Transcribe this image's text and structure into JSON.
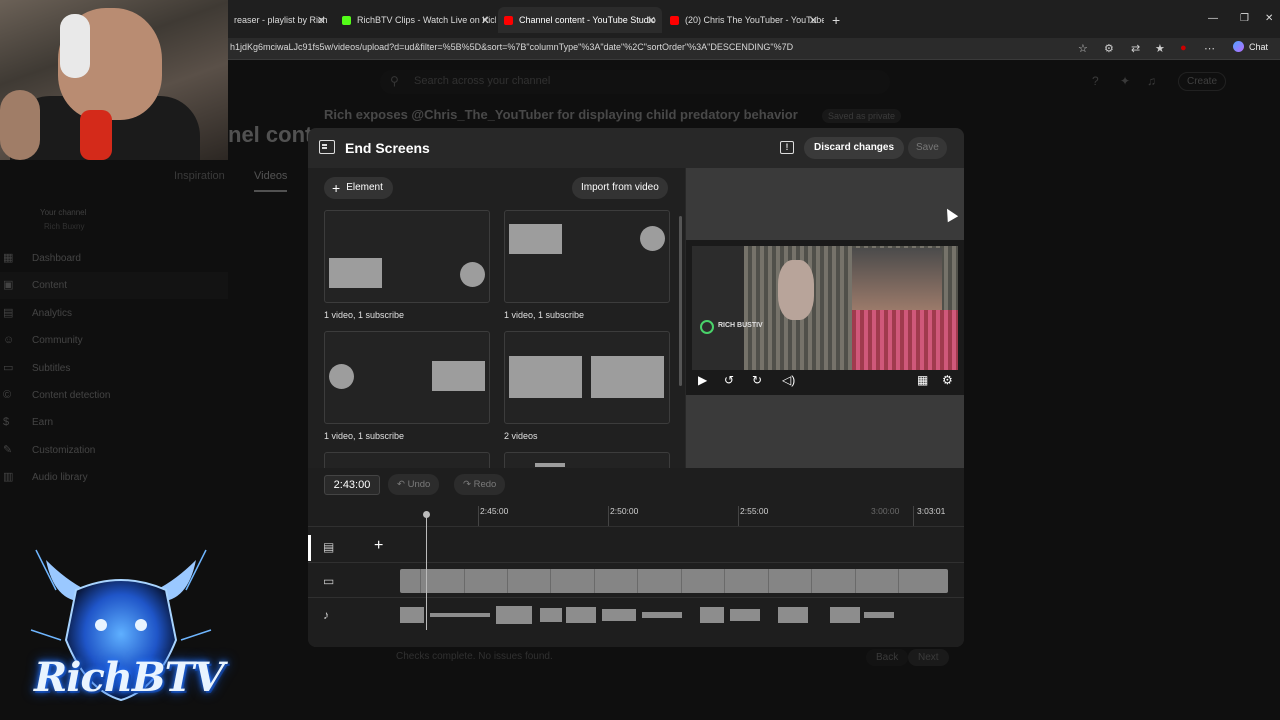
{
  "browser": {
    "tabs": [
      {
        "title": "reaser - playlist by Rich",
        "color": "#ff0000"
      },
      {
        "title": "RichBTV Clips - Watch Live on Kick",
        "color": "#53fc18"
      },
      {
        "title": "Channel content - YouTube Studio",
        "color": "#ff0000",
        "active": true
      },
      {
        "title": "(20) Chris The YouTuber - YouTube",
        "color": "#ff0000"
      }
    ],
    "url": "h1jdKg6mciwaLJc91fs5w/videos/upload?d=ud&filter=%5B%5D&sort=%7B\"columnType\"%3A\"date\"%2C\"sortOrder\"%3A\"DESCENDING\"%7D",
    "chat_label": "Chat"
  },
  "studio": {
    "search_placeholder": "Search across your channel",
    "create_label": "Create",
    "channel_heading": "nel cont",
    "your_channel": "Your channel",
    "channel_name": "Rich Buxny",
    "tabs": [
      "Inspiration",
      "Videos"
    ],
    "nav": [
      "Dashboard",
      "Content",
      "Analytics",
      "Community",
      "Subtitles",
      "Content detection",
      "Earn",
      "Customization",
      "Audio library"
    ],
    "draft_title": "Rich exposes @Chris_The_YouTuber for displaying child predatory behavior",
    "saved_label": "Saved as private",
    "checks_status": "Checks complete. No issues found.",
    "back_label": "Back",
    "next_label": "Next"
  },
  "overlay": {
    "logo_text": "RichBTV"
  },
  "modal": {
    "title": "End Screens",
    "discard_label": "Discard changes",
    "save_label": "Save",
    "element_label": "Element",
    "import_label": "Import from video",
    "templates": [
      {
        "label": "1 video, 1 subscribe"
      },
      {
        "label": "1 video, 1 subscribe"
      },
      {
        "label": "1 video, 1 subscribe"
      },
      {
        "label": "2 videos"
      }
    ],
    "preview_logo": "RICH BUSTIV"
  },
  "timeline": {
    "current_time": "2:43:00",
    "undo_label": "Undo",
    "redo_label": "Redo",
    "ruler": [
      "2:45:00",
      "2:50:00",
      "2:55:00",
      "3:00:00",
      "3:03:01"
    ]
  },
  "colors": {
    "accent_red": "#ff0000",
    "kick_green": "#53fc18",
    "logo_blue": "#2b7bff"
  }
}
